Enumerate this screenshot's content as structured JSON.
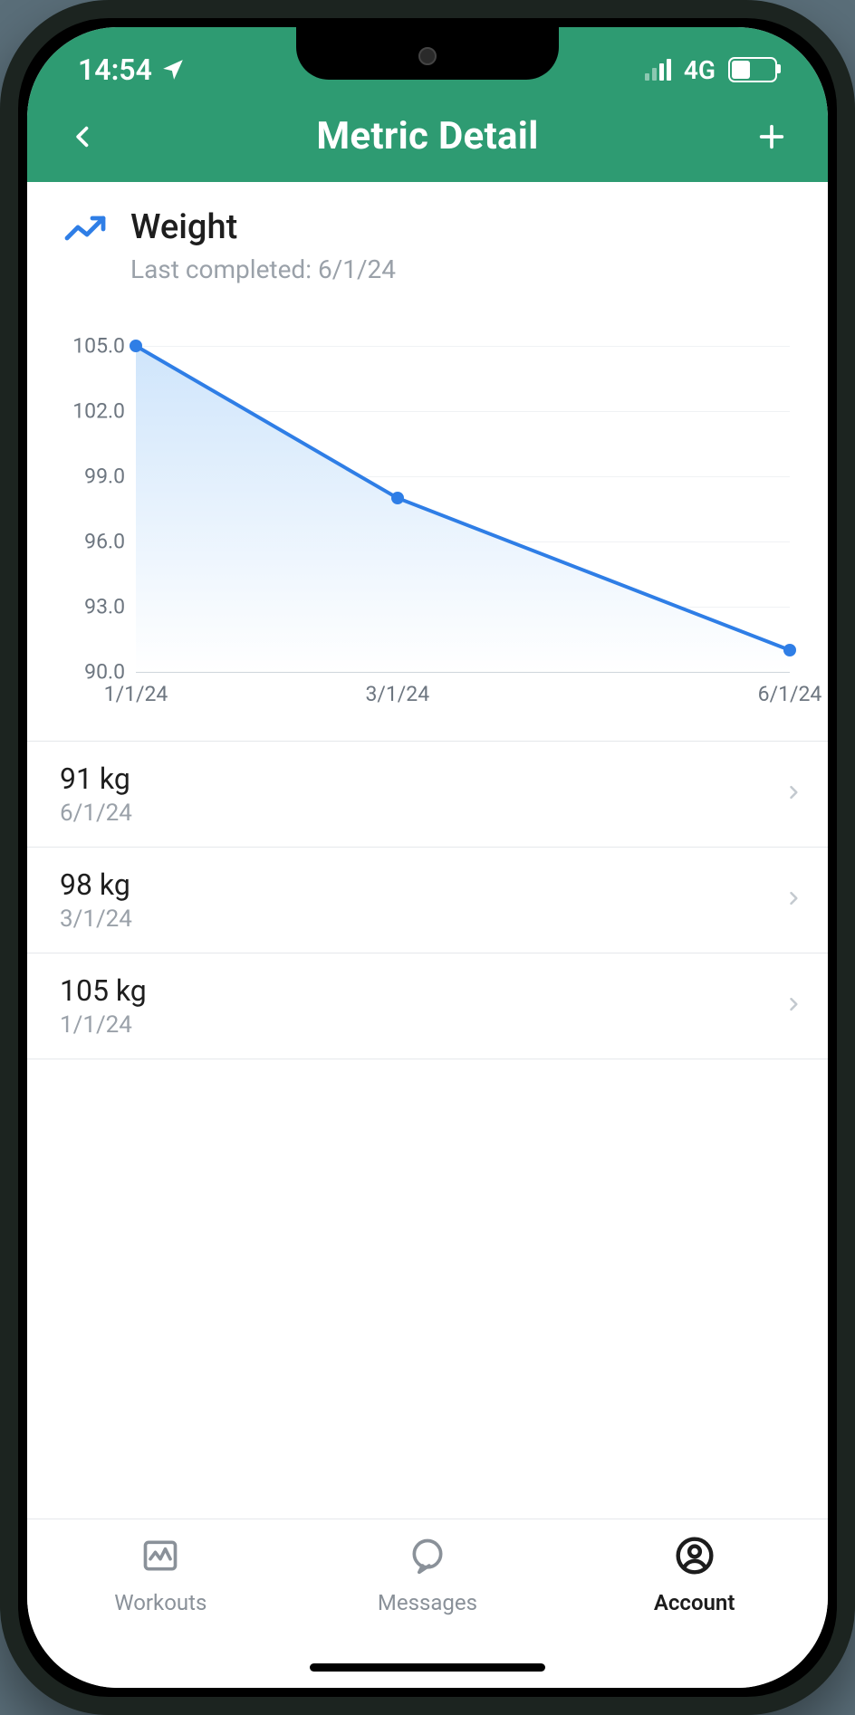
{
  "status": {
    "time": "14:54",
    "network": "4G"
  },
  "nav": {
    "title": "Metric Detail"
  },
  "metric": {
    "name": "Weight",
    "subtitle": "Last completed: 6/1/24"
  },
  "chart_data": {
    "type": "area",
    "x": [
      "1/1/24",
      "3/1/24",
      "6/1/24"
    ],
    "values": [
      105,
      98,
      91
    ],
    "x_ticks": [
      "1/1/24",
      "3/1/24",
      "6/1/24"
    ],
    "y_ticks": [
      90.0,
      93.0,
      96.0,
      99.0,
      102.0,
      105.0
    ],
    "ylim": [
      90.0,
      105.0
    ],
    "xlabel": "",
    "ylabel": "",
    "title": ""
  },
  "entries": [
    {
      "value": "91 kg",
      "date": "6/1/24"
    },
    {
      "value": "98 kg",
      "date": "3/1/24"
    },
    {
      "value": "105 kg",
      "date": "1/1/24"
    }
  ],
  "tabs": [
    {
      "label": "Workouts",
      "active": false
    },
    {
      "label": "Messages",
      "active": false
    },
    {
      "label": "Account",
      "active": true
    }
  ]
}
